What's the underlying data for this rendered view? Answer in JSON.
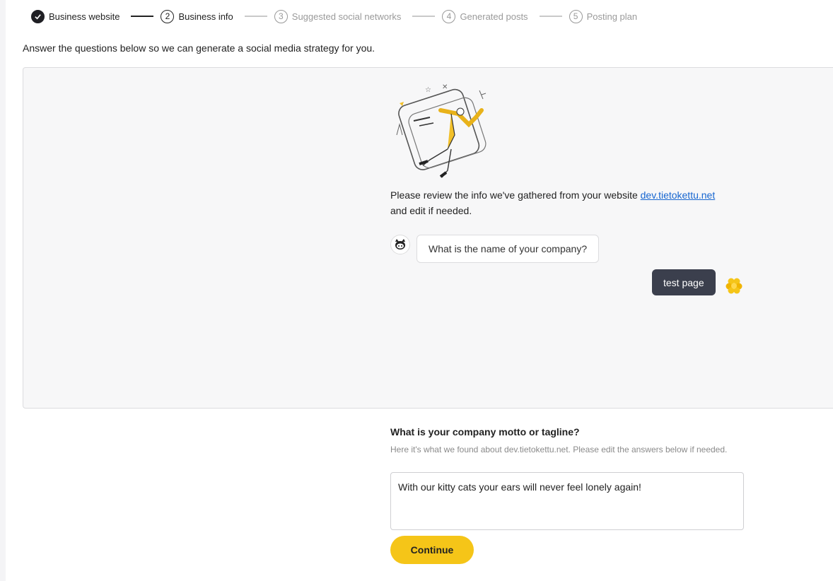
{
  "stepper": {
    "steps": [
      {
        "number": "1",
        "label": "Business website",
        "state": "done"
      },
      {
        "number": "2",
        "label": "Business info",
        "state": "active"
      },
      {
        "number": "3",
        "label": "Suggested social networks",
        "state": "pending"
      },
      {
        "number": "4",
        "label": "Generated posts",
        "state": "pending"
      },
      {
        "number": "5",
        "label": "Posting plan",
        "state": "pending"
      }
    ]
  },
  "intro": "Answer the questions below so we can generate a social media strategy for you.",
  "chat": {
    "review_text": "Please review the info we've gathered from your website",
    "review_link": "dev.tietokettu.net",
    "review_suffix": "and edit if needed.",
    "bot_question": "What is the name of your company?",
    "user_answer": "test page"
  },
  "question": {
    "title": "What is your company motto or tagline?",
    "hint": "Here it's what we found about dev.tietokettu.net. Please edit the answers below if needed.",
    "answer": "With our kitty cats your ears will never feel lonely again!"
  },
  "buttons": {
    "continue": "Continue"
  },
  "colors": {
    "accent": "#f5c518",
    "user_bubble": "#3b3f4d",
    "link": "#1766d0"
  }
}
